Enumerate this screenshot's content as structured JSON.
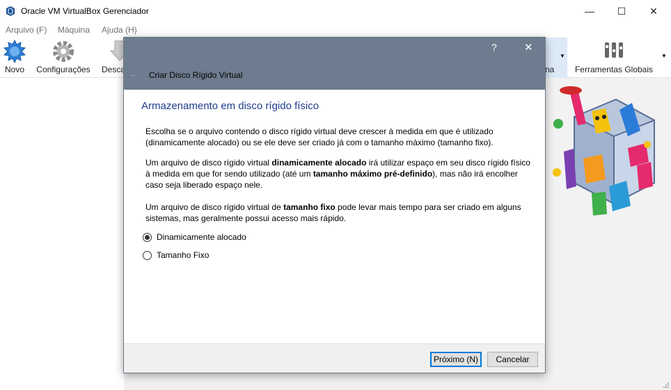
{
  "window": {
    "title": "Oracle VM VirtualBox Gerenciador",
    "minimize_glyph": "—",
    "maximize_glyph": "☐",
    "close_glyph": "✕"
  },
  "menu": {
    "items": [
      {
        "label": "Arquivo (F)"
      },
      {
        "label": "Máquina"
      },
      {
        "label": "Ajuda (H)"
      }
    ]
  },
  "toolbar": {
    "novo": "Novo",
    "configuracoes": "Configurações",
    "descartar": "Desca",
    "partial_right": "na",
    "ferramentas_globais": "Ferramentas Globais"
  },
  "dialog": {
    "help_glyph": "?",
    "close_glyph": "✕",
    "back_glyph": "🡐",
    "title": "Criar Disco Rígido Virtual",
    "heading": "Armazenamento em disco rígido físico",
    "para1": "Escolha se o arquivo contendo o disco rígido virtual deve crescer à medida em que é utilizado (dinamicamente alocado) ou se ele deve ser criado já com o tamanho máximo (tamanho fixo).",
    "para2": {
      "t1": "Um arquivo de disco rígido virtual ",
      "b1": "dinamicamente alocado",
      "t2": " irá utilizar espaço em seu disco rígido físico à medida em que for sendo utilizado (até um ",
      "b2": "tamanho máximo pré-definido",
      "t3": "), mas não irá encolher caso seja liberado espaço nele."
    },
    "para3": {
      "t1": "Um arquivo de disco rígido virtual de ",
      "b1": "tamanho fixo",
      "t2": " pode levar mais tempo para ser criado em alguns sistemas, mas geralmente possui acesso mais rápido."
    },
    "options": [
      {
        "label": "Dinamicamente alocado",
        "selected": true
      },
      {
        "label": "Tamanho Fixo",
        "selected": false
      }
    ],
    "next_label": "Próximo (N)",
    "cancel_label": "Cancelar"
  },
  "colors": {
    "dialog_header": "#6d7c8e",
    "heading": "#1e3c8c",
    "default_button_border": "#0078d7"
  }
}
